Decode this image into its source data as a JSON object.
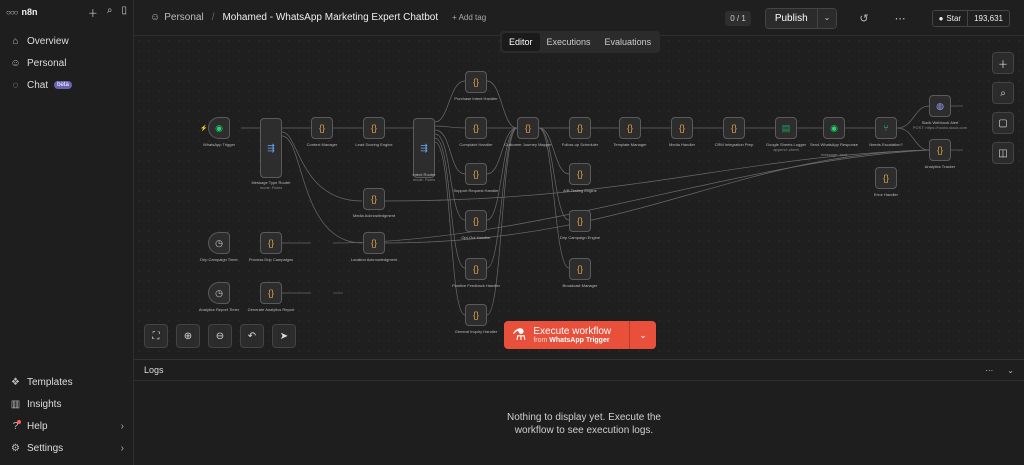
{
  "sidebar": {
    "brand": "n8n",
    "items": [
      {
        "label": "Overview",
        "icon": "home-icon"
      },
      {
        "label": "Personal",
        "icon": "user-icon"
      },
      {
        "label": "Chat",
        "icon": "chat-icon",
        "badge": "beta"
      }
    ],
    "bottom_items": [
      {
        "label": "Templates",
        "icon": "templates-icon"
      },
      {
        "label": "Insights",
        "icon": "insights-icon"
      },
      {
        "label": "Help",
        "icon": "help-icon"
      },
      {
        "label": "Settings",
        "icon": "settings-icon"
      }
    ]
  },
  "header": {
    "breadcrumb_project": "Personal",
    "breadcrumb_sep": "/",
    "workflow_name": "Mohamed - WhatsApp Marketing Expert Chatbot",
    "add_tag": "+ Add tag",
    "version_counter": "0 / 1",
    "publish_label": "Publish",
    "github_star": "Star",
    "github_count": "193,631"
  },
  "tabs": [
    {
      "label": "Editor",
      "active": true
    },
    {
      "label": "Executions",
      "active": false
    },
    {
      "label": "Evaluations",
      "active": false
    }
  ],
  "nodes": [
    {
      "id": "n1",
      "label": "WhatsApp Trigger"
    },
    {
      "id": "n2",
      "label": "Message Type Router",
      "sub": "mode: Rules"
    },
    {
      "id": "n3",
      "label": "Context Manager"
    },
    {
      "id": "n4",
      "label": "Lead Scoring Engine"
    },
    {
      "id": "n5",
      "label": "Intent Router",
      "sub": "mode: Rules"
    },
    {
      "id": "n6",
      "label": "Purchase Intent Handler"
    },
    {
      "id": "n7",
      "label": "Complaint Handler"
    },
    {
      "id": "n8",
      "label": "Support Request Handler"
    },
    {
      "id": "n9",
      "label": "Opt-Out Handler"
    },
    {
      "id": "n10",
      "label": "Positive Feedback Handler"
    },
    {
      "id": "n11",
      "label": "General Inquiry Handler"
    },
    {
      "id": "n12",
      "label": "Customer Journey Mapper"
    },
    {
      "id": "n13",
      "label": "Follow-up Scheduler"
    },
    {
      "id": "n14",
      "label": "A/B Testing Engine"
    },
    {
      "id": "n15",
      "label": "Drip Campaign Engine"
    },
    {
      "id": "n16",
      "label": "Broadcast Manager"
    },
    {
      "id": "n17",
      "label": "Template Manager"
    },
    {
      "id": "n18",
      "label": "Media Handler"
    },
    {
      "id": "n19",
      "label": "CRM Integration Prep"
    },
    {
      "id": "n20",
      "label": "Google Sheets Logger",
      "sub": "append: sheet"
    },
    {
      "id": "n21",
      "label": "Send WhatsApp Response",
      "sub": "message: sent"
    },
    {
      "id": "n22",
      "label": "Needs Escalation?"
    },
    {
      "id": "n23",
      "label": "Slack Webhook Alert",
      "sub": "POST: https://hooks.slack.com"
    },
    {
      "id": "n24",
      "label": "Analytics Tracker"
    },
    {
      "id": "n25",
      "label": "Error Handler"
    },
    {
      "id": "n26",
      "label": "Media Acknowledgment"
    },
    {
      "id": "n27",
      "label": "Location Acknowledgment"
    },
    {
      "id": "n28",
      "label": "Drip Campaign Timer"
    },
    {
      "id": "n29",
      "label": "Process Drip Campaigns"
    },
    {
      "id": "n30",
      "label": "Analytics Report Timer"
    },
    {
      "id": "n31",
      "label": "Generate Analytics Report"
    }
  ],
  "execute": {
    "title": "Execute workflow",
    "from_prefix": "from",
    "from_node": "WhatsApp Trigger"
  },
  "logs": {
    "title": "Logs",
    "empty_message": "Nothing to display yet. Execute the workflow to see execution logs."
  }
}
